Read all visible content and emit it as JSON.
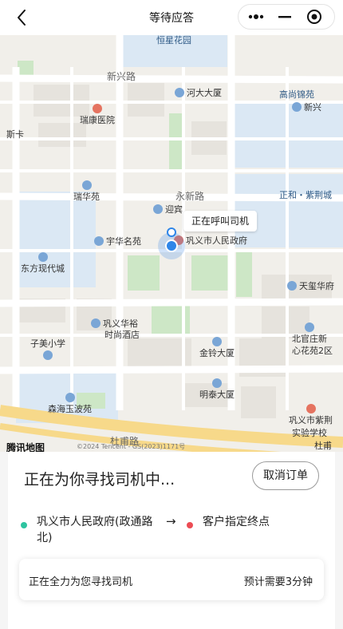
{
  "header": {
    "title": "等待应答",
    "back_icon": "back-arrow-icon",
    "capsule": {
      "more_icon": "more-dots-icon",
      "minimize_icon": "minimize-icon",
      "close_icon": "target-close-icon"
    }
  },
  "map": {
    "roads": [
      "新兴路",
      "永新路",
      "杜甫路"
    ],
    "labels": [
      "恒星花园",
      "河大大厦",
      "高尚锦苑",
      "新兴",
      "瑞康医院",
      "斯卡",
      "瑞华苑",
      "迎宾",
      "正和・紫荆城",
      "宇华名苑",
      "巩义市人民政府",
      "东方现代城",
      "天玺华府",
      "巩义华裕",
      "时尚酒店",
      "子美小学",
      "北官庄新",
      "心花苑2区",
      "金铃大厦",
      "明泰大厦",
      "森海玉波苑",
      "巩义市紫荆",
      "实验学校",
      "杜甫"
    ],
    "bubble": "正在呼叫司机",
    "logo": "腾讯地图",
    "copyright": "©2024 Tencent - GS(2023)1171号"
  },
  "panel": {
    "status": "正在为你寻找司机中...",
    "cancel_label": "取消订单",
    "origin": "巩义市人民政府(政通路北)",
    "arrow": "→",
    "destination": "客户指定终点",
    "progress_msg": "正在全力为您寻找司机",
    "eta": "预计需要3分钟"
  },
  "colors": {
    "origin_dot": "#2ec4a0",
    "destination_dot": "#ec4c54",
    "location": "#2f86e8"
  }
}
